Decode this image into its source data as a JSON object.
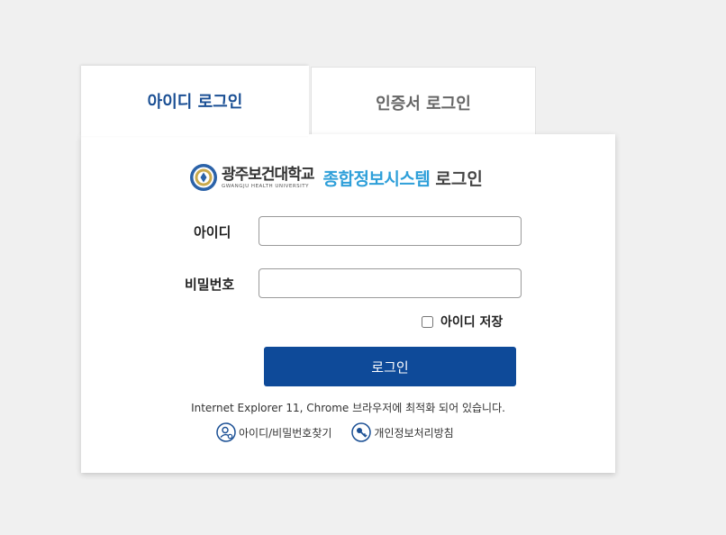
{
  "tabs": {
    "id_login": "아이디 로그인",
    "cert_login": "인증서 로그인"
  },
  "brand": {
    "university": "광주보건대학교",
    "university_en": "GWANGJU HEALTH UNIVERSITY",
    "system": "종합정보시스템",
    "login": "로그인"
  },
  "form": {
    "id_label": "아이디",
    "id_value": "",
    "password_label": "비밀번호",
    "password_value": "",
    "save_id_label": "아이디 저장",
    "save_id_checked": false,
    "login_button": "로그인"
  },
  "notice": "Internet Explorer 11, Chrome 브라우저에 최적화 되어 있습니다.",
  "links": {
    "find_account": "아이디/비밀번호찾기",
    "privacy_policy": "개인정보처리방침"
  },
  "colors": {
    "primary": "#0e4a99",
    "tab_active_text": "#1a4f94",
    "system_name": "#2e9fd9",
    "background": "#f0f0f0"
  },
  "icons": {
    "emblem": "university-emblem-icon",
    "find_account": "user-search-icon",
    "privacy_policy": "key-icon"
  }
}
